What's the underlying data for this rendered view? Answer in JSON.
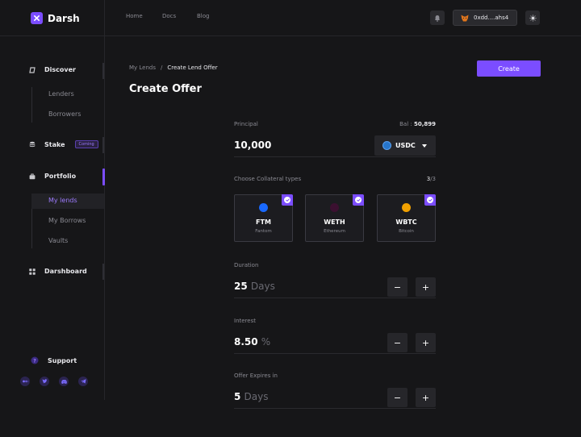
{
  "header": {
    "brand": "Darsh",
    "nav": [
      "Home",
      "Docs",
      "Blog"
    ],
    "wallet_address": "0xdd....ahs4"
  },
  "sidebar": {
    "discover": "Discover",
    "lenders": "Lenders",
    "borrowers": "Borrowers",
    "stake": "Stake",
    "stake_badge": "Coming",
    "portfolio": "Portfolio",
    "my_lends": "My lends",
    "my_borrows": "My Borrows",
    "vaults": "Vaults",
    "dashboard": "Darshboard",
    "support": "Support"
  },
  "page": {
    "breadcrumb_parent": "My Lends",
    "breadcrumb_sep": "/",
    "breadcrumb_current": "Create Lend Offer",
    "title": "Create Offer",
    "create_button": "Create"
  },
  "form": {
    "principal_label": "Principal",
    "balance_label": "Bal :",
    "balance_value": "50,899",
    "principal_value": "10,000",
    "token": "USDC",
    "collateral_label": "Choose Collateral types",
    "collateral_selected": "3",
    "collateral_total": "/3",
    "collaterals": [
      {
        "symbol": "FTM",
        "name": "Fantom",
        "color": "#1969ff"
      },
      {
        "symbol": "WETH",
        "name": "Ethereum",
        "color": "#3b1030"
      },
      {
        "symbol": "WBTC",
        "name": "Bitcoin",
        "color": "#f0a000"
      }
    ],
    "duration_label": "Duration",
    "duration_value": "25",
    "duration_unit": "Days",
    "interest_label": "Interest",
    "interest_value": "8.50",
    "interest_unit": "%",
    "expires_label": "Offer Expires in",
    "expires_value": "5",
    "expires_unit": "Days",
    "minus": "−",
    "plus": "+"
  },
  "colors": {
    "accent": "#7b4dff",
    "background": "#161618"
  }
}
